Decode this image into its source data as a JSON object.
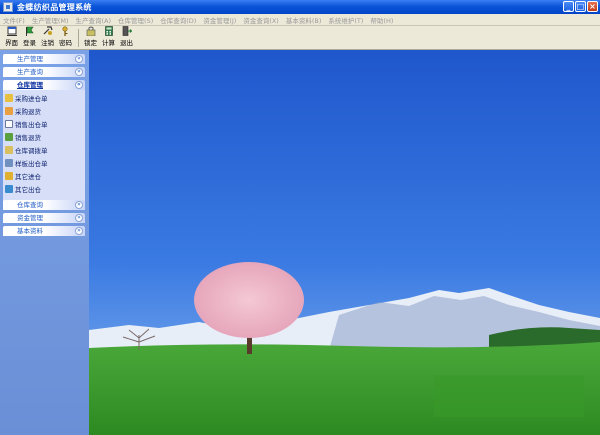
{
  "window": {
    "title": "金蝶纺织品管理系统"
  },
  "menu": [
    "文件(F)",
    "生产管理(M)",
    "生产查询(A)",
    "仓库管理(S)",
    "仓库查询(D)",
    "资金管理(J)",
    "资金查询(X)",
    "基本资料(B)",
    "系统维护(T)",
    "帮助(H)"
  ],
  "toolbar": {
    "items": [
      "界面",
      "登录",
      "注销",
      "密码",
      "锁定",
      "计算",
      "退出"
    ]
  },
  "sidebar": {
    "groups_top": [
      "生产管理",
      "生产查询"
    ],
    "active_group": "仓库管理",
    "items": [
      "采购进仓单",
      "采购退货",
      "销售出仓单",
      "销售退货",
      "仓库调拨单",
      "样板出仓单",
      "其它进仓",
      "其它出仓"
    ],
    "groups_bottom": [
      "仓库查询",
      "资金管理",
      "基本资料"
    ]
  },
  "colors": {
    "title_bar": "#0a55d8",
    "sidebar": "#6b8fd6",
    "sky": "#2f68d8",
    "grass": "#3a9a2a"
  }
}
